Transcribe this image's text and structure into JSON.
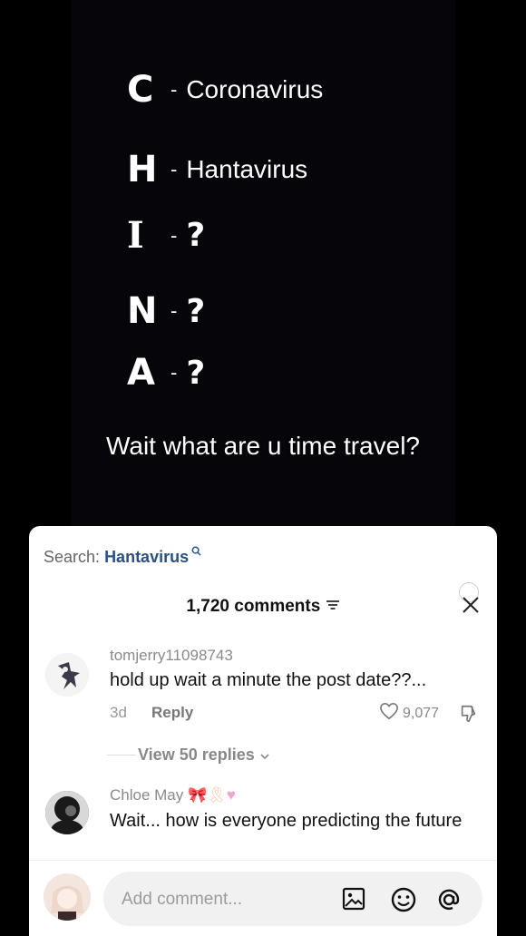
{
  "video": {
    "rows": [
      {
        "letter": "C",
        "dash": "-",
        "word": "Coronavirus"
      },
      {
        "letter": "H",
        "dash": "-",
        "word": "Hantavirus"
      },
      {
        "letter": "I",
        "dash": "-",
        "word": "?"
      },
      {
        "letter": "N",
        "dash": "-",
        "word": "?"
      },
      {
        "letter": "A",
        "dash": "-",
        "word": "?"
      }
    ],
    "caption": "Wait what are u time travel?"
  },
  "comments_sheet": {
    "search_label": "Search:",
    "search_term": "Hantavirus",
    "count_label": "1,720 comments",
    "comments": [
      {
        "username": "tomjerry11098743",
        "text": "hold up wait a minute the post date??...",
        "age": "3d",
        "reply_label": "Reply",
        "likes": "9,077",
        "view_replies": "View 50 replies"
      },
      {
        "username": "Chloe May",
        "text": "Wait... how is everyone predicting the future"
      }
    ],
    "input_placeholder": "Add comment..."
  },
  "colors": {
    "search_term": "#2a4f8a",
    "sheet_bg": "#ffffff",
    "video_bg": "#060509"
  },
  "icons": [
    "sort-icon",
    "close-icon",
    "heart-icon",
    "dislike-icon",
    "chevron-down-icon",
    "image-icon",
    "emoji-icon",
    "mention-icon"
  ]
}
